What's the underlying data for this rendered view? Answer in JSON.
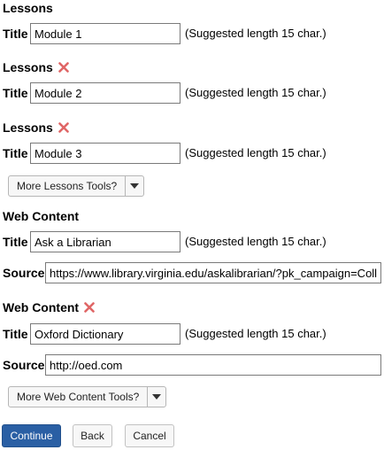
{
  "lessons": [
    {
      "heading": "Lessons",
      "removable": false,
      "title_label": "Title",
      "title_value": "Module 1",
      "hint": "(Suggested length 15 char.)"
    },
    {
      "heading": "Lessons",
      "removable": true,
      "title_label": "Title",
      "title_value": "Module 2",
      "hint": "(Suggested length 15 char.)"
    },
    {
      "heading": "Lessons",
      "removable": true,
      "title_label": "Title",
      "title_value": "Module 3",
      "hint": "(Suggested length 15 char.)"
    }
  ],
  "lessons_tools": {
    "label": "More Lessons Tools?"
  },
  "web_content": [
    {
      "heading": "Web Content",
      "removable": false,
      "title_label": "Title",
      "title_value": "Ask a Librarian",
      "hint": "(Suggested length 15 char.)",
      "source_label": "Source",
      "source_value": "https://www.library.virginia.edu/askalibrarian/?pk_campaign=Colla"
    },
    {
      "heading": "Web Content",
      "removable": true,
      "title_label": "Title",
      "title_value": "Oxford Dictionary",
      "hint": "(Suggested length 15 char.)",
      "source_label": "Source",
      "source_value": "http://oed.com"
    }
  ],
  "web_content_tools": {
    "label": "More Web Content Tools?"
  },
  "actions": {
    "continue": "Continue",
    "back": "Back",
    "cancel": "Cancel"
  },
  "colors": {
    "primary": "#2a5fa4",
    "remove_icon": "#e06666"
  },
  "icons": {
    "remove": "remove-x-icon",
    "caret": "caret-down-icon"
  }
}
